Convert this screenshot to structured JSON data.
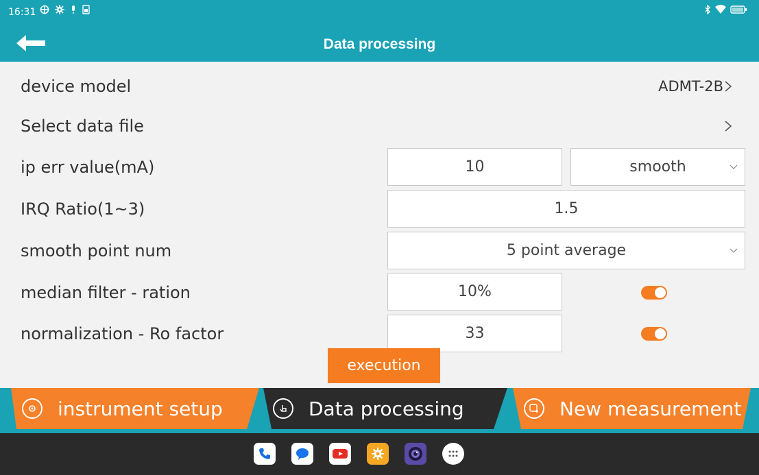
{
  "status_bar": {
    "time": "16:31"
  },
  "header": {
    "title": "Data processing"
  },
  "rows": {
    "device_model": {
      "label": "device model",
      "value": "ADMT-2B"
    },
    "select_file": {
      "label": "Select data file"
    },
    "ip_err": {
      "label": "ip err value(mA)",
      "value": "10",
      "mode": "smooth"
    },
    "irq_ratio": {
      "label": "IRQ Ratio(1~3)",
      "value": "1.5"
    },
    "smooth_point": {
      "label": "smooth point num",
      "value": "5 point average"
    },
    "median_filter": {
      "label": "median filter - ration",
      "value": "10%",
      "enabled": true
    },
    "normalization": {
      "label": "normalization - Ro factor",
      "value": "33",
      "enabled": true
    }
  },
  "execute_label": "execution",
  "tabs": [
    {
      "label": "instrument setup",
      "active": false
    },
    {
      "label": "Data processing",
      "active": true
    },
    {
      "label": "New measurement",
      "active": false
    }
  ],
  "dock": [
    "phone-icon",
    "messages-icon",
    "youtube-icon",
    "settings-icon",
    "camera-icon",
    "apps-icon"
  ],
  "colors": {
    "primary": "#1aa3b5",
    "accent": "#f57c20",
    "tab_active": "#2b2b2b"
  }
}
